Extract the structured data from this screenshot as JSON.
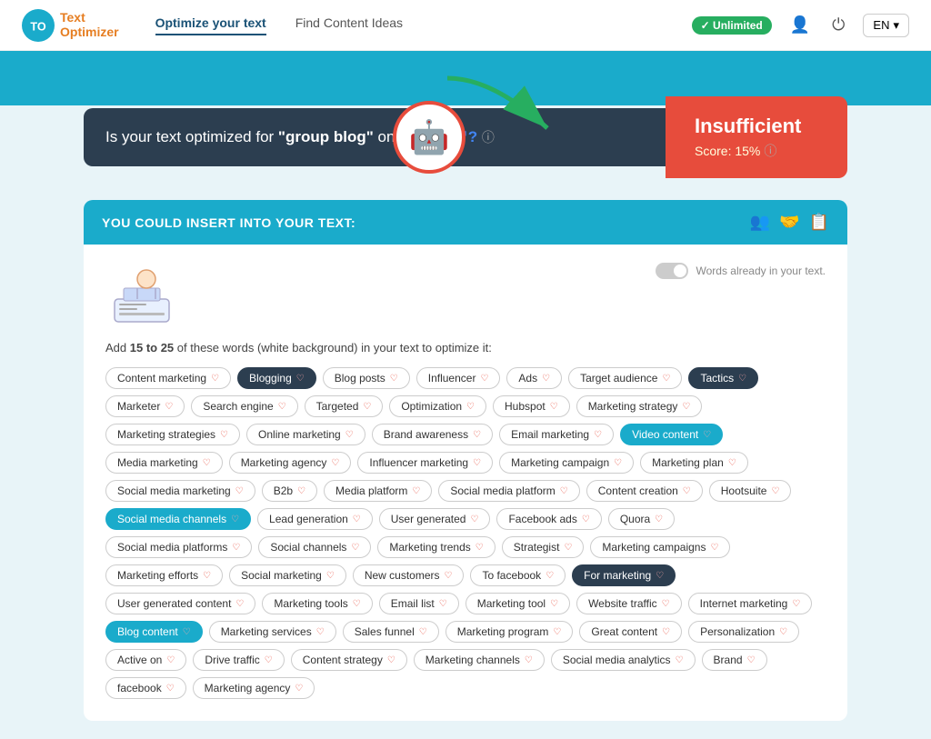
{
  "header": {
    "logo_line1": "Text",
    "logo_line2": "Optimizer",
    "nav": [
      {
        "label": "Optimize your text",
        "active": true
      },
      {
        "label": "Find Content Ideas",
        "active": false
      }
    ],
    "unlimited_label": "✓ Unlimited",
    "lang_label": "EN"
  },
  "score_banner": {
    "question": "Is your text optimized for \"group blog\" on",
    "google_label": "Google™?",
    "status_label": "Insufficient",
    "score_label": "Score: 15%"
  },
  "insert_section": {
    "title": "YOU COULD INSERT INTO YOUR TEXT:",
    "toggle_label": "Words already in your text."
  },
  "instruction": {
    "text_start": "Add ",
    "highlight": "15 to 25",
    "text_end": " of these words (white background) in your text to optimize it:"
  },
  "tags": [
    {
      "label": "Content marketing",
      "style": "normal"
    },
    {
      "label": "Blogging",
      "style": "highlighted"
    },
    {
      "label": "Blog posts",
      "style": "normal"
    },
    {
      "label": "Influencer",
      "style": "normal"
    },
    {
      "label": "Ads",
      "style": "normal"
    },
    {
      "label": "Target audience",
      "style": "normal"
    },
    {
      "label": "Tactics",
      "style": "highlighted"
    },
    {
      "label": "Marketer",
      "style": "normal"
    },
    {
      "label": "Search engine",
      "style": "normal"
    },
    {
      "label": "Targeted",
      "style": "normal"
    },
    {
      "label": "Optimization",
      "style": "normal"
    },
    {
      "label": "Hubspot",
      "style": "normal"
    },
    {
      "label": "Marketing strategy",
      "style": "normal"
    },
    {
      "label": "Marketing strategies",
      "style": "normal"
    },
    {
      "label": "Online marketing",
      "style": "normal"
    },
    {
      "label": "Brand awareness",
      "style": "normal"
    },
    {
      "label": "Email marketing",
      "style": "normal"
    },
    {
      "label": "Video content",
      "style": "teal"
    },
    {
      "label": "Media marketing",
      "style": "normal"
    },
    {
      "label": "Marketing agency",
      "style": "normal"
    },
    {
      "label": "Influencer marketing",
      "style": "normal"
    },
    {
      "label": "Marketing campaign",
      "style": "normal"
    },
    {
      "label": "Marketing plan",
      "style": "normal"
    },
    {
      "label": "Social media marketing",
      "style": "normal"
    },
    {
      "label": "B2b",
      "style": "normal"
    },
    {
      "label": "Media platform",
      "style": "normal"
    },
    {
      "label": "Social media platform",
      "style": "normal"
    },
    {
      "label": "Content creation",
      "style": "normal"
    },
    {
      "label": "Hootsuite",
      "style": "normal"
    },
    {
      "label": "Social media channels",
      "style": "teal"
    },
    {
      "label": "Lead generation",
      "style": "normal"
    },
    {
      "label": "User generated",
      "style": "normal"
    },
    {
      "label": "Facebook ads",
      "style": "normal"
    },
    {
      "label": "Quora",
      "style": "normal"
    },
    {
      "label": "Social media platforms",
      "style": "normal"
    },
    {
      "label": "Social channels",
      "style": "normal"
    },
    {
      "label": "Marketing trends",
      "style": "normal"
    },
    {
      "label": "Strategist",
      "style": "normal"
    },
    {
      "label": "Marketing campaigns",
      "style": "normal"
    },
    {
      "label": "Marketing efforts",
      "style": "normal"
    },
    {
      "label": "Social marketing",
      "style": "normal"
    },
    {
      "label": "New customers",
      "style": "normal"
    },
    {
      "label": "To facebook",
      "style": "normal"
    },
    {
      "label": "For marketing",
      "style": "highlighted"
    },
    {
      "label": "User generated content",
      "style": "normal"
    },
    {
      "label": "Marketing tools",
      "style": "normal"
    },
    {
      "label": "Email list",
      "style": "normal"
    },
    {
      "label": "Marketing tool",
      "style": "normal"
    },
    {
      "label": "Website traffic",
      "style": "normal"
    },
    {
      "label": "Internet marketing",
      "style": "normal"
    },
    {
      "label": "Blog content",
      "style": "teal"
    },
    {
      "label": "Marketing services",
      "style": "normal"
    },
    {
      "label": "Sales funnel",
      "style": "normal"
    },
    {
      "label": "Marketing program",
      "style": "normal"
    },
    {
      "label": "Great content",
      "style": "normal"
    },
    {
      "label": "Personalization",
      "style": "normal"
    },
    {
      "label": "Active on",
      "style": "normal"
    },
    {
      "label": "Drive traffic",
      "style": "normal"
    },
    {
      "label": "Content strategy",
      "style": "normal"
    },
    {
      "label": "Marketing channels",
      "style": "normal"
    },
    {
      "label": "Social media analytics",
      "style": "normal"
    },
    {
      "label": "Brand",
      "style": "normal"
    },
    {
      "label": "facebook",
      "style": "normal"
    },
    {
      "label": "Marketing agency",
      "style": "normal"
    }
  ]
}
